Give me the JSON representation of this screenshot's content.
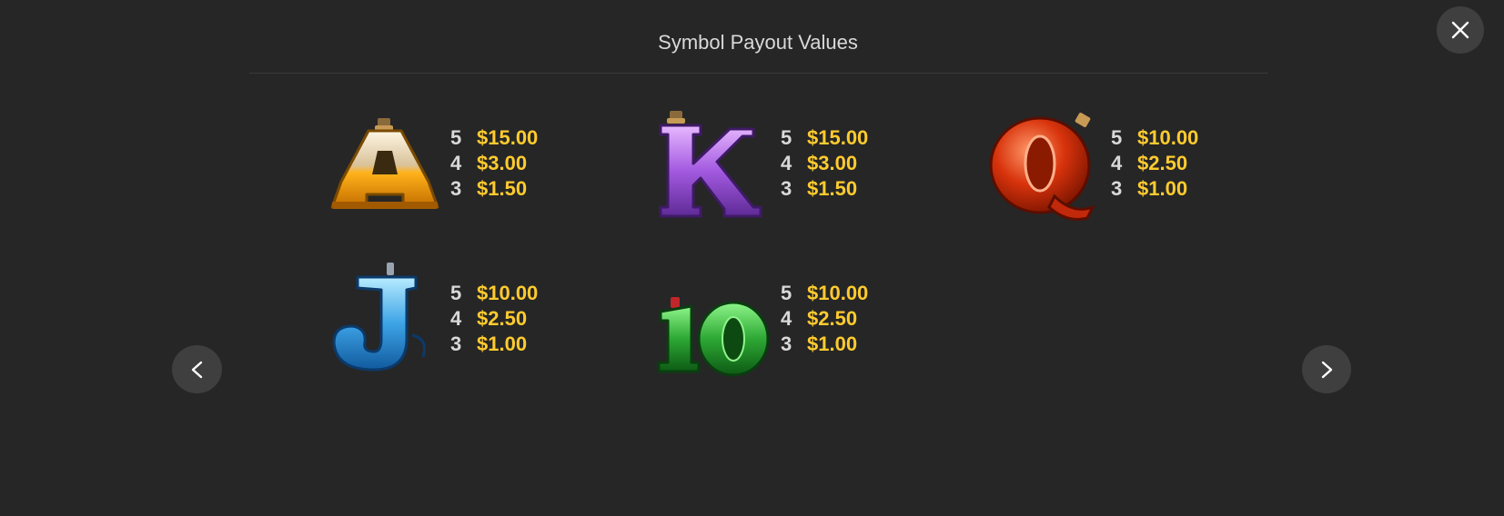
{
  "header": {
    "title": "Symbol Payout Values"
  },
  "controls": {
    "close_icon": "close-icon",
    "prev_icon": "chevron-left-icon",
    "next_icon": "chevron-right-icon"
  },
  "colors": {
    "background": "#262626",
    "count_text": "#d9d9d9",
    "payout_text": "#ffcb2f",
    "button_bg": "#3f3f3f"
  },
  "symbols": [
    {
      "symbol": "A",
      "icon": "letter-a-symbol-icon",
      "color": "#f2a20d",
      "payouts": [
        {
          "count": "5",
          "value": "$15.00"
        },
        {
          "count": "4",
          "value": "$3.00"
        },
        {
          "count": "3",
          "value": "$1.50"
        }
      ]
    },
    {
      "symbol": "K",
      "icon": "letter-k-symbol-icon",
      "color": "#a35ae0",
      "payouts": [
        {
          "count": "5",
          "value": "$15.00"
        },
        {
          "count": "4",
          "value": "$3.00"
        },
        {
          "count": "3",
          "value": "$1.50"
        }
      ]
    },
    {
      "symbol": "Q",
      "icon": "letter-q-symbol-icon",
      "color": "#d8330c",
      "payouts": [
        {
          "count": "5",
          "value": "$10.00"
        },
        {
          "count": "4",
          "value": "$2.50"
        },
        {
          "count": "3",
          "value": "$1.00"
        }
      ]
    },
    {
      "symbol": "J",
      "icon": "letter-j-symbol-icon",
      "color": "#3da4e6",
      "payouts": [
        {
          "count": "5",
          "value": "$10.00"
        },
        {
          "count": "4",
          "value": "$2.50"
        },
        {
          "count": "3",
          "value": "$1.00"
        }
      ]
    },
    {
      "symbol": "10",
      "icon": "number-10-symbol-icon",
      "color": "#2da834",
      "payouts": [
        {
          "count": "5",
          "value": "$10.00"
        },
        {
          "count": "4",
          "value": "$2.50"
        },
        {
          "count": "3",
          "value": "$1.00"
        }
      ]
    }
  ]
}
